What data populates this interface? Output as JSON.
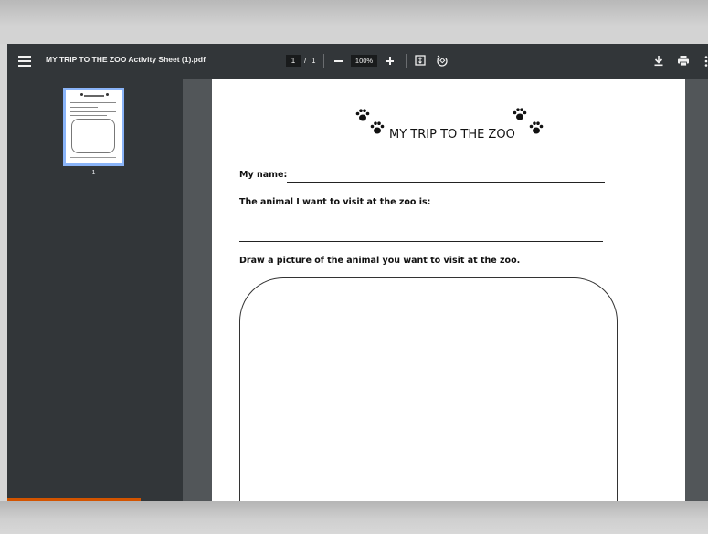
{
  "toolbar": {
    "title": "MY TRIP TO THE ZOO Activity Sheet (1).pdf",
    "current_page": "1",
    "page_separator": "/",
    "total_pages": "1",
    "zoom": "100%"
  },
  "sidebar": {
    "thumbnail_label": "1"
  },
  "document": {
    "heading": "MY TRIP TO THE ZOO",
    "name_label": "My name: ",
    "animal_label": "The animal I want to visit at the zoo is:",
    "draw_label": "Draw a picture of the animal you want to visit at the zoo."
  },
  "colors": {
    "toolbar_bg": "#323639",
    "viewer_bg": "#525659",
    "thumbnail_highlight": "#8ab4f8",
    "sidebar_accent": "#d35400"
  },
  "icons": [
    "menu-icon",
    "zoom-out-icon",
    "zoom-in-icon",
    "fit-page-icon",
    "rotate-icon",
    "download-icon",
    "print-icon",
    "more-options-icon",
    "paw-print-icon"
  ]
}
